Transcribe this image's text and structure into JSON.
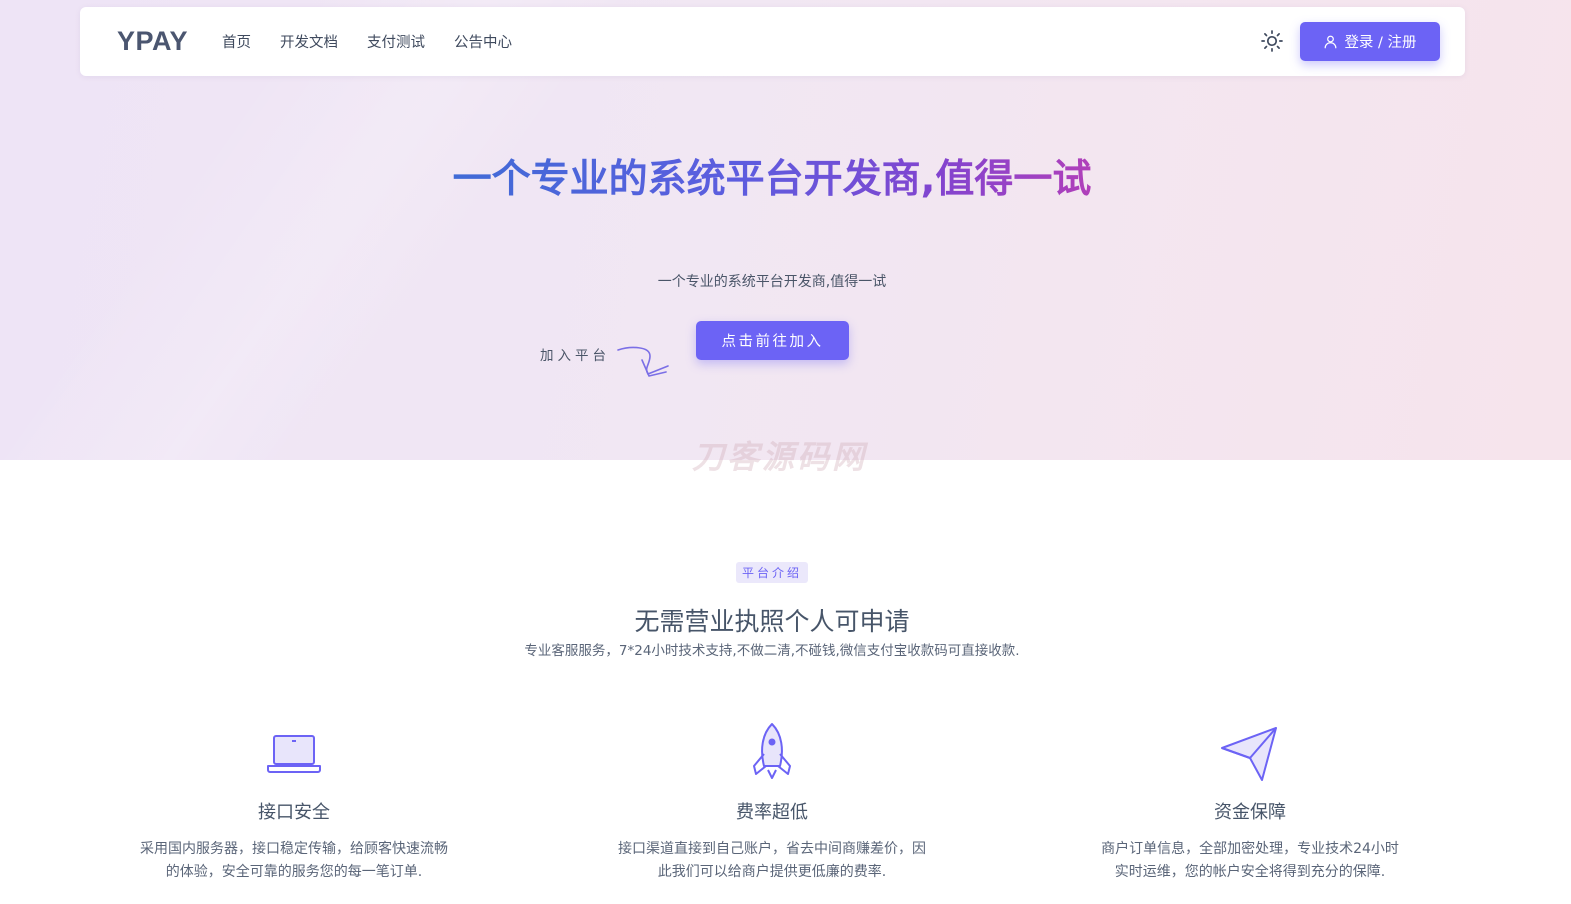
{
  "nav": {
    "logo": "YPAY",
    "links": [
      "首页",
      "开发文档",
      "支付测试",
      "公告中心"
    ],
    "login_label": "登录 / 注册"
  },
  "hero": {
    "title": "一个专业的系统平台开发商,值得一试",
    "subtitle": "一个专业的系统平台开发商,值得一试",
    "join_button": "点击前往加入",
    "join_label": "加入平台"
  },
  "watermark": "刀客源码网",
  "intro": {
    "badge": "平台介绍",
    "title": "无需营业执照个人可申请",
    "subtitle": "专业客服服务，7*24小时技术支持,不做二清,不碰钱,微信支付宝收款码可直接收款."
  },
  "features": [
    {
      "icon": "laptop-icon",
      "title": "接口安全",
      "desc": "采用国内服务器，接口稳定传输，给顾客快速流畅的体验，安全可靠的服务您的每一笔订单."
    },
    {
      "icon": "rocket-icon",
      "title": "费率超低",
      "desc": "接口渠道直接到自己账户，省去中间商赚差价，因此我们可以给商户提供更低廉的费率."
    },
    {
      "icon": "send-icon",
      "title": "资金保障",
      "desc": "商户订单信息，全部加密处理，专业技术24小时实时运维，您的帐户安全将得到充分的保障."
    }
  ],
  "colors": {
    "accent": "#6c63f5",
    "icon_stroke": "#6c63f5",
    "hero_bg": "#f1e7f3"
  }
}
